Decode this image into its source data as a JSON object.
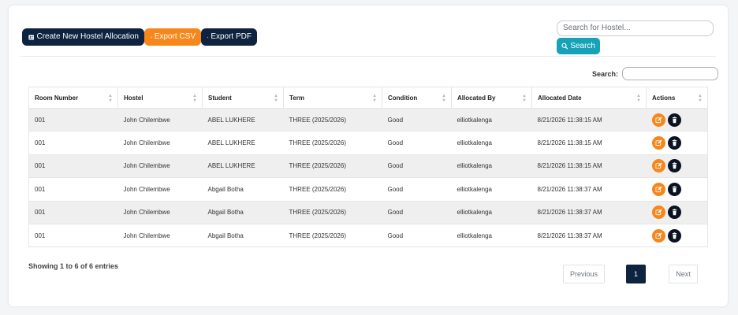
{
  "toolbar": {
    "create_label": "Create New Hostel Allocation",
    "export_csv_label": "Export CSV",
    "export_pdf_label": "Export PDF"
  },
  "search": {
    "placeholder": "Search for Hostel...",
    "button_label": "Search"
  },
  "datatable_search": {
    "label": "Search:"
  },
  "table": {
    "columns": [
      "Room Number",
      "Hostel",
      "Student",
      "Term",
      "Condition",
      "Allocated By",
      "Allocated Date",
      "Actions"
    ],
    "rows": [
      [
        "001",
        "John Chilembwe",
        "ABEL LUKHERE",
        "THREE (2025/2026)",
        "Good",
        "elliotkalenga",
        "8/21/2026 11:38:15 AM"
      ],
      [
        "001",
        "John Chilembwe",
        "ABEL LUKHERE",
        "THREE (2025/2026)",
        "Good",
        "elliotkalenga",
        "8/21/2026 11:38:15 AM"
      ],
      [
        "001",
        "John Chilembwe",
        "ABEL LUKHERE",
        "THREE (2025/2026)",
        "Good",
        "elliotkalenga",
        "8/21/2026 11:38:15 AM"
      ],
      [
        "001",
        "John Chilembwe",
        "Abgail Botha",
        "THREE (2025/2026)",
        "Good",
        "elliotkalenga",
        "8/21/2026 11:38:37 AM"
      ],
      [
        "001",
        "John Chilembwe",
        "Abgail Botha",
        "THREE (2025/2026)",
        "Good",
        "elliotkalenga",
        "8/21/2026 11:38:37 AM"
      ],
      [
        "001",
        "John Chilembwe",
        "Abgail Botha",
        "THREE (2025/2026)",
        "Good",
        "elliotkalenga",
        "8/21/2026 11:38:37 AM"
      ]
    ]
  },
  "footer": {
    "info": "Showing 1 to 6 of 6 entries",
    "previous": "Previous",
    "page": "1",
    "next": "Next"
  },
  "colors": {
    "primary": "#0e2340",
    "accent_orange": "#f7861b",
    "search_teal": "#17a2b8",
    "delete_dark": "#0b1222"
  }
}
